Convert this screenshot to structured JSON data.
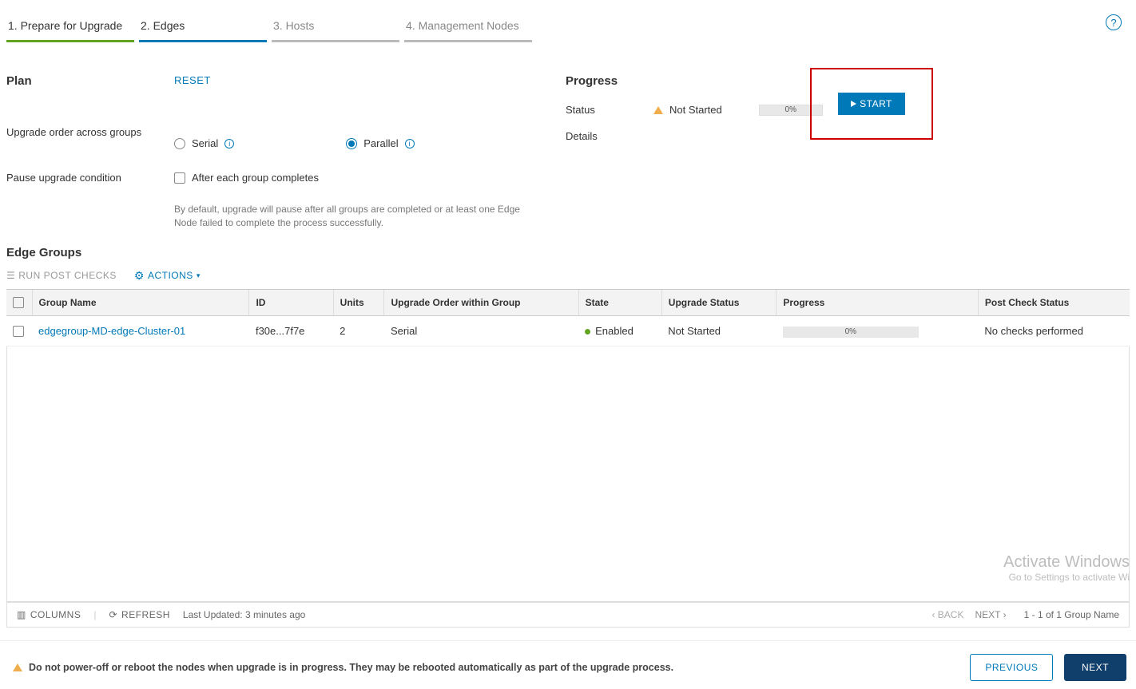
{
  "tabs": {
    "t1": "1. Prepare for Upgrade",
    "t2": "2. Edges",
    "t3": "3. Hosts",
    "t4": "4. Management Nodes"
  },
  "plan": {
    "title": "Plan",
    "reset": "RESET",
    "order_label": "Upgrade order across groups",
    "serial": "Serial",
    "parallel": "Parallel",
    "pause_label": "Pause upgrade condition",
    "pause_opt": "After each group completes",
    "default_note": "By default, upgrade will pause after all groups are completed or at least one Edge Node failed to complete the process successfully."
  },
  "progress": {
    "title": "Progress",
    "status_label": "Status",
    "status_value": "Not Started",
    "details_label": "Details",
    "percent": "0%",
    "start": "START"
  },
  "edge_groups": {
    "title": "Edge Groups",
    "run_post": "RUN POST CHECKS",
    "actions": "ACTIONS",
    "columns": {
      "name": "Group Name",
      "id": "ID",
      "units": "Units",
      "order": "Upgrade Order within Group",
      "state": "State",
      "ustatus": "Upgrade Status",
      "progress": "Progress",
      "post": "Post Check Status"
    },
    "rows": [
      {
        "name": "edgegroup-MD-edge-Cluster-01",
        "id": "f30e...7f7e",
        "units": "2",
        "order": "Serial",
        "state": "Enabled",
        "ustatus": "Not Started",
        "progress": "0%",
        "post": "No checks performed"
      }
    ]
  },
  "footer": {
    "columns": "COLUMNS",
    "refresh": "REFRESH",
    "updated": "Last Updated: 3 minutes ago",
    "back": "BACK",
    "next": "NEXT",
    "count": "1 - 1 of 1 Group Name"
  },
  "watermark": {
    "l1": "Activate Windows",
    "l2": "Go to Settings to activate Wi"
  },
  "bottom": {
    "warning": "Do not power-off or reboot the nodes when upgrade is in progress. They may be rebooted automatically as part of the upgrade process.",
    "previous": "PREVIOUS",
    "next": "NEXT"
  }
}
